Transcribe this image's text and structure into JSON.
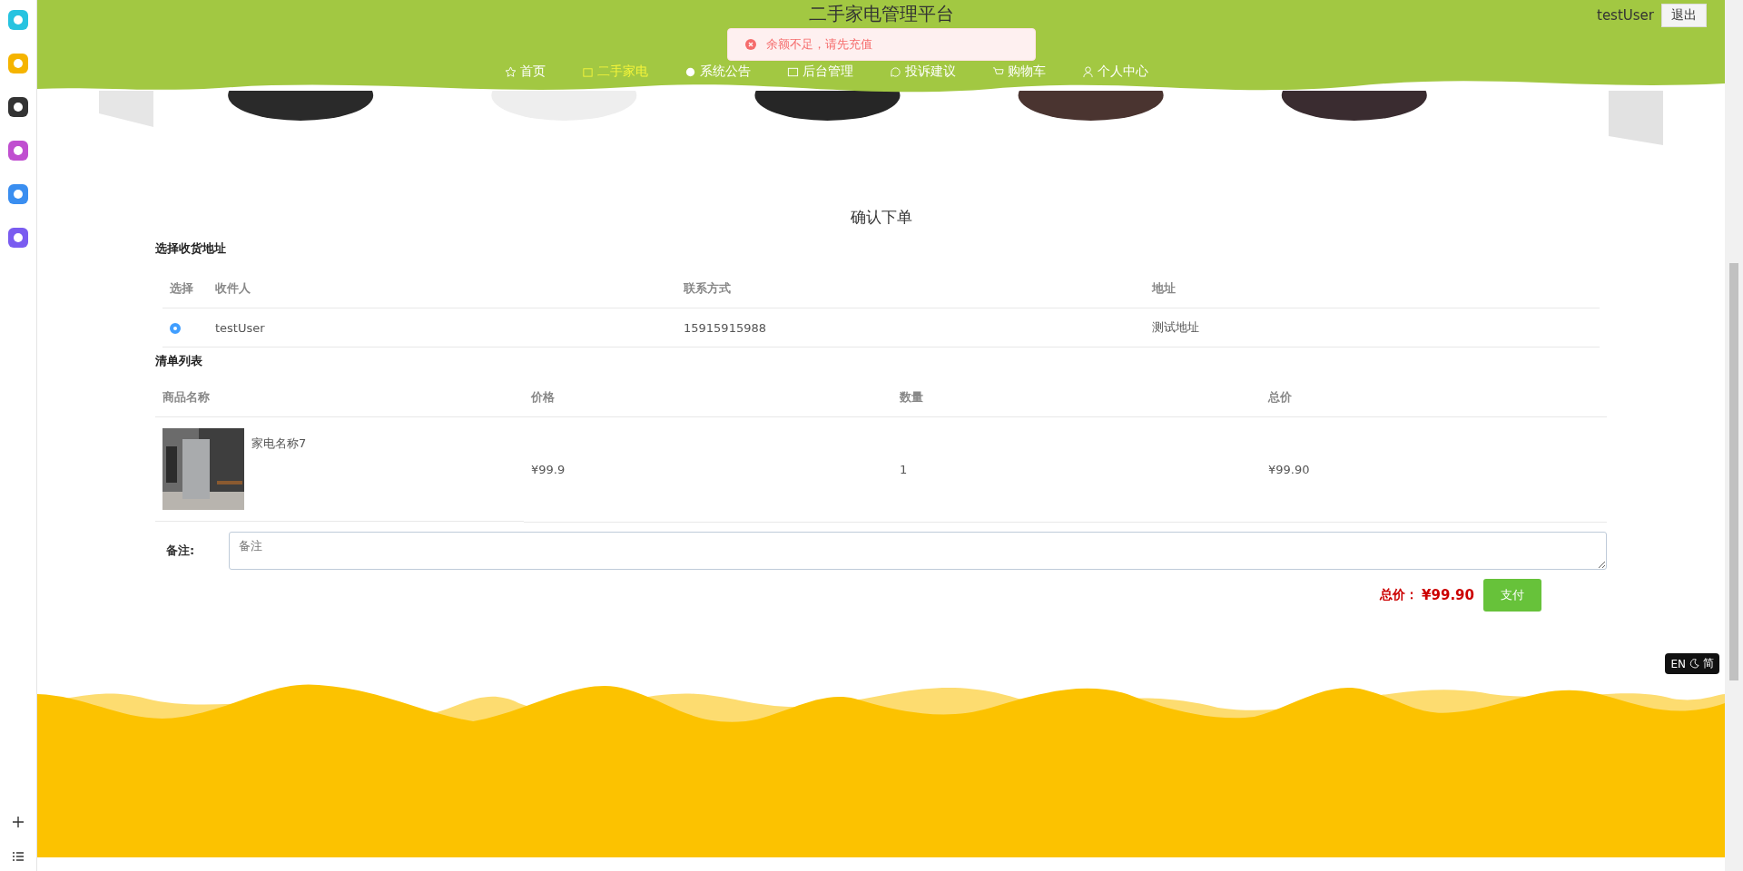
{
  "header": {
    "title": "二手家电管理平台",
    "user": "testUser",
    "logout": "退出",
    "nav": [
      {
        "label": "首页",
        "selected": false
      },
      {
        "label": "二手家电",
        "selected": true
      },
      {
        "label": "系统公告",
        "selected": false
      },
      {
        "label": "后台管理",
        "selected": false
      },
      {
        "label": "投诉建议",
        "selected": false
      },
      {
        "label": "购物车",
        "selected": false
      },
      {
        "label": "个人中心",
        "selected": false
      }
    ]
  },
  "toast": {
    "message": "余额不足，请先充值"
  },
  "page_title": "确认下单",
  "address_section": {
    "title": "选择收货地址",
    "columns": [
      "选择",
      "收件人",
      "联系方式",
      "地址"
    ],
    "rows": [
      {
        "selected": true,
        "name": "testUser",
        "phone": "15915915988",
        "address": "测试地址"
      }
    ]
  },
  "items_section": {
    "title": "清单列表",
    "columns": [
      "商品名称",
      "价格",
      "数量",
      "总价"
    ],
    "rows": [
      {
        "name": "家电名称7",
        "price": "¥99.9",
        "quantity": "1",
        "total": "¥99.90"
      }
    ]
  },
  "remark": {
    "label": "备注:",
    "placeholder": "备注"
  },
  "total": {
    "label": "总价：",
    "value": "¥99.90"
  },
  "pay_button": "支付",
  "language_badge": {
    "left": "EN",
    "right": "简"
  }
}
